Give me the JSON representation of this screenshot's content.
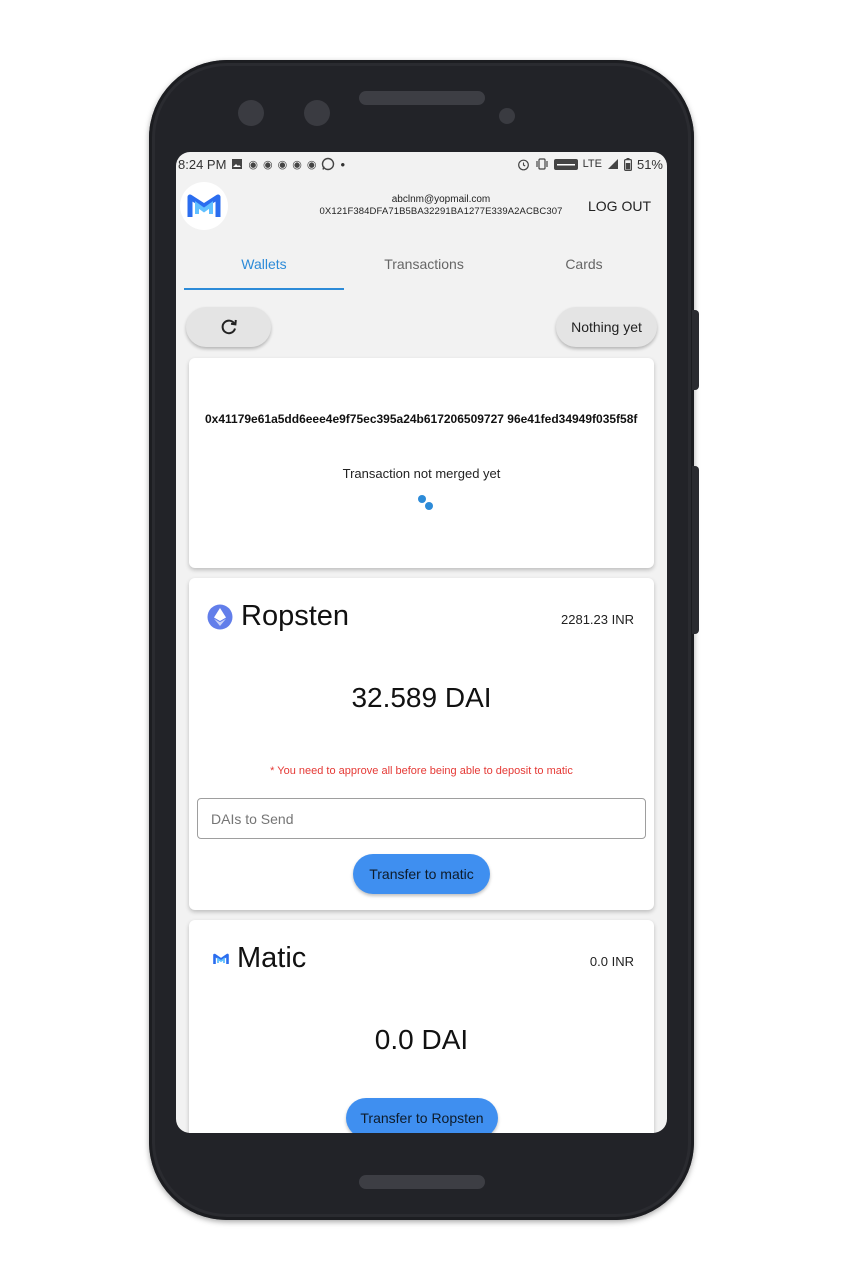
{
  "status_bar": {
    "time": "8:24 PM",
    "dot": "•",
    "network": "LTE",
    "battery": "51%"
  },
  "header": {
    "email": "abclnm@yopmail.com",
    "address": "0X121F384DFA71B5BA32291BA1277E339A2ACBC307",
    "logout_label": "LOG OUT"
  },
  "tabs": [
    {
      "label": "Wallets",
      "active": true
    },
    {
      "label": "Transactions",
      "active": false
    },
    {
      "label": "Cards",
      "active": false
    }
  ],
  "actions": {
    "refresh_icon": "refresh-icon",
    "nothing_label": "Nothing yet"
  },
  "pending_tx": {
    "hash": "0x41179e61a5dd6eee4e9f75ec395a24b617206509727 96e41fed34949f035f58f",
    "status": "Transaction not merged yet"
  },
  "ropsten": {
    "name": "Ropsten",
    "inr": "2281.23 INR",
    "balance": "32.589 DAI",
    "warning": "* You need to approve all before being able to deposit to matic",
    "input_placeholder": "DAIs to Send",
    "button_label": "Transfer to matic"
  },
  "matic": {
    "name": "Matic",
    "inr": "0.0 INR",
    "balance": "0.0 DAI",
    "button_label": "Transfer to Ropsten"
  },
  "colors": {
    "accent": "#2d8bd8",
    "button": "#3f8ff0",
    "warning": "#e53935",
    "ethereum": "#627eea"
  }
}
